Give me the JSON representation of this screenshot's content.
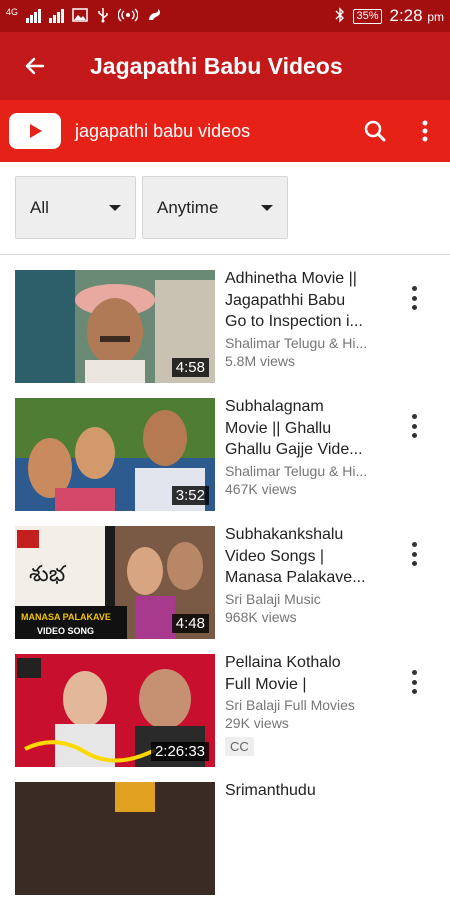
{
  "status_bar": {
    "network": "4G",
    "battery": "35%",
    "time": "2:28",
    "ampm": "pm"
  },
  "app_bar": {
    "title": "Jagapathi Babu Videos"
  },
  "search_bar": {
    "query": "jagapathi babu videos"
  },
  "filters": [
    {
      "label": "All"
    },
    {
      "label": "Anytime"
    }
  ],
  "videos": [
    {
      "title_lines": [
        "Adhinetha Movie ||",
        "Jagapathhi Babu",
        "Go to Inspection i..."
      ],
      "channel": "Shalimar Telugu & Hi...",
      "views": "5.8M views",
      "duration": "4:58"
    },
    {
      "title_lines": [
        "Subhalagnam",
        "Movie || Ghallu",
        "Ghallu Gajje Vide..."
      ],
      "channel": "Shalimar Telugu & Hi...",
      "views": "467K views",
      "duration": "3:52"
    },
    {
      "title_lines": [
        "Subhakankshalu",
        "Video Songs |",
        "Manasa Palakave..."
      ],
      "channel": "Sri Balaji Music",
      "views": "968K views",
      "duration": "4:48",
      "thumb_caption": "MANASA PALAKAVE",
      "thumb_caption2": "VIDEO SONG"
    },
    {
      "title_lines": [
        "Pellaina Kothalo",
        "Full Movie |",
        ""
      ],
      "channel": "Sri Balaji Full Movies",
      "views": "29K views",
      "duration": "2:26:33",
      "badge": "CC"
    },
    {
      "title_lines": [
        "Srimanthudu",
        "",
        ""
      ],
      "channel": "",
      "views": "",
      "duration": ""
    }
  ],
  "colors": {
    "status_bar": "#a30f0f",
    "app_bar": "#c4191a",
    "search_bar": "#e62117"
  }
}
